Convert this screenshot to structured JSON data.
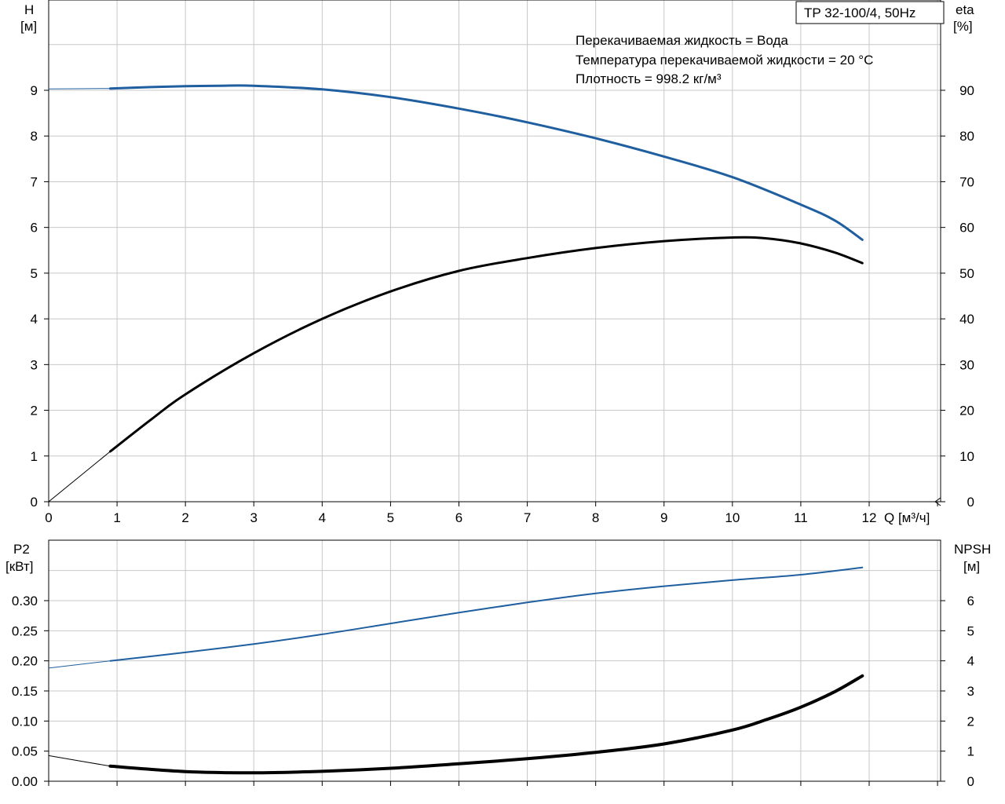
{
  "model": "TP 32-100/4, 50Hz",
  "conditions": [
    "Перекачиваемая жидкость = Вода",
    "Температура перекачиваемой жидкости = 20 °C",
    "Плотность = 998.2 кг/м³"
  ],
  "colors": {
    "blue": "#1f5fa0",
    "black": "#000000",
    "grid": "#c8c8c8"
  },
  "chart_data": [
    {
      "type": "line",
      "left_axis": {
        "label": [
          "H",
          "[м]"
        ],
        "ylim": [
          0,
          10
        ],
        "ticks": [
          "0",
          "1",
          "2",
          "3",
          "4",
          "5",
          "6",
          "7",
          "8",
          "9"
        ]
      },
      "right_axis": {
        "label": [
          "eta",
          "[%]"
        ],
        "ylim": [
          0,
          100
        ],
        "ticks": [
          "0",
          "10",
          "20",
          "30",
          "40",
          "50",
          "60",
          "70",
          "80",
          "90"
        ]
      },
      "x_axis": {
        "label": "Q [м³/ч]",
        "xlim": [
          0,
          13
        ],
        "ticks": [
          "0",
          "1",
          "2",
          "3",
          "4",
          "5",
          "6",
          "7",
          "8",
          "9",
          "10",
          "11",
          "12"
        ]
      },
      "grid": true,
      "series": [
        {
          "id": "H",
          "axis": "left",
          "color": "blue",
          "x": [
            0,
            0.9,
            1.5,
            2,
            2.5,
            3,
            4,
            5,
            6,
            7,
            8,
            9,
            10,
            11,
            11.5,
            11.9
          ],
          "y": [
            9.03,
            9.04,
            9.07,
            9.09,
            9.1,
            9.1,
            9.02,
            8.85,
            8.6,
            8.3,
            7.95,
            7.55,
            7.1,
            6.5,
            6.15,
            5.73
          ]
        },
        {
          "id": "eta",
          "axis": "right",
          "color": "black",
          "x": [
            0,
            0.9,
            1.5,
            2,
            3,
            4,
            5,
            6,
            7,
            8,
            9,
            10,
            10.5,
            11,
            11.5,
            11.9
          ],
          "y": [
            0,
            11,
            18,
            23.5,
            32.5,
            40,
            46,
            50.5,
            53.3,
            55.5,
            57,
            57.8,
            57.6,
            56.5,
            54.5,
            52.2
          ]
        }
      ]
    },
    {
      "type": "line",
      "left_axis": {
        "label": [
          "P2",
          "[кВт]"
        ],
        "ylim": [
          0,
          0.4
        ],
        "ticks": [
          "0.00",
          "0.05",
          "0.10",
          "0.15",
          "0.20",
          "0.25",
          "0.30"
        ]
      },
      "right_axis": {
        "label": [
          "NPSH",
          "[м]"
        ],
        "ylim": [
          0,
          8
        ],
        "ticks": [
          "0",
          "1",
          "2",
          "3",
          "4",
          "5",
          "6"
        ]
      },
      "x_axis": {
        "xlim": [
          0,
          13
        ]
      },
      "grid": true,
      "series": [
        {
          "id": "P2",
          "axis": "left",
          "color": "blue",
          "x": [
            0,
            0.9,
            2,
            3,
            4,
            5,
            6,
            7,
            8,
            9,
            10,
            11,
            11.9
          ],
          "y": [
            0.188,
            0.2,
            0.214,
            0.228,
            0.244,
            0.262,
            0.28,
            0.297,
            0.312,
            0.324,
            0.334,
            0.343,
            0.355
          ]
        },
        {
          "id": "NPSH",
          "axis": "right",
          "color": "black",
          "x": [
            0,
            0.9,
            2,
            3,
            4,
            5,
            6,
            7,
            8,
            9,
            10,
            10.5,
            11,
            11.5,
            11.9
          ],
          "y": [
            0.85,
            0.5,
            0.32,
            0.28,
            0.33,
            0.43,
            0.58,
            0.75,
            0.96,
            1.24,
            1.7,
            2.05,
            2.46,
            2.98,
            3.5
          ]
        }
      ]
    }
  ]
}
